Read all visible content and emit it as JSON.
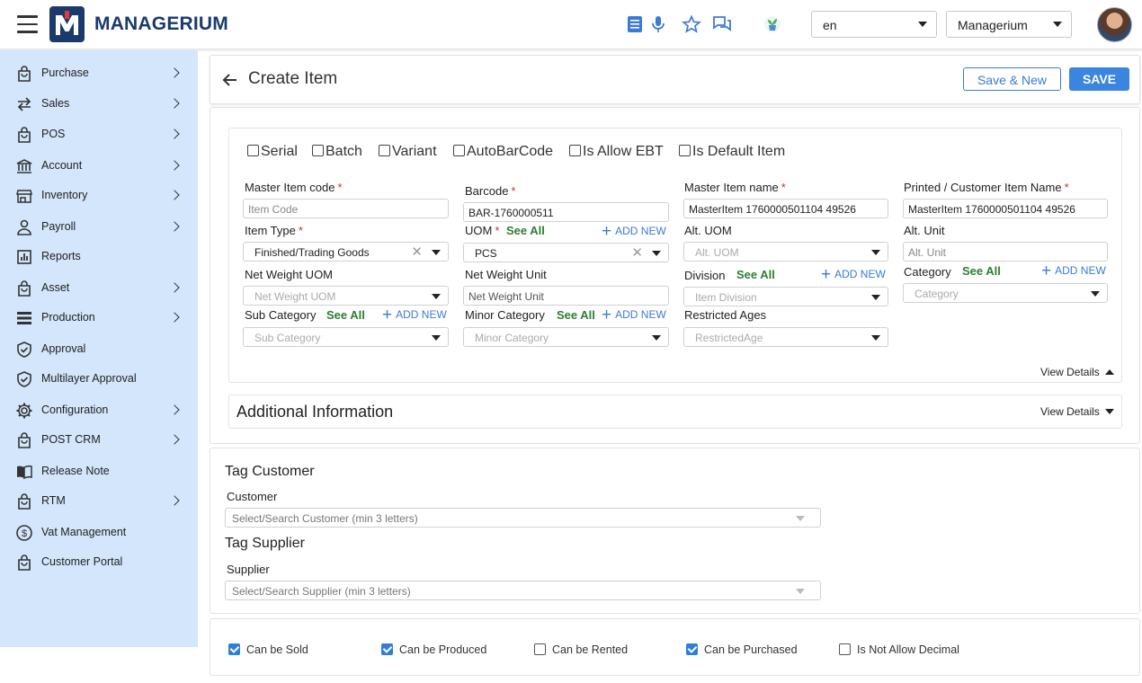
{
  "header": {
    "brand": "MANAGERIUM",
    "language": "en",
    "company": "Managerium"
  },
  "sidebar": {
    "items": [
      {
        "label": "Purchase",
        "icon": "shopping-bag-icon",
        "has_children": true
      },
      {
        "label": "Sales",
        "icon": "swap-arrows-icon",
        "has_children": true
      },
      {
        "label": "POS",
        "icon": "shopping-bag-icon",
        "has_children": true
      },
      {
        "label": "Account",
        "icon": "bank-icon",
        "has_children": true
      },
      {
        "label": "Inventory",
        "icon": "store-icon",
        "has_children": true
      },
      {
        "label": "Payroll",
        "icon": "person-icon",
        "has_children": true
      },
      {
        "label": "Reports",
        "icon": "bar-chart-icon",
        "has_children": false
      },
      {
        "label": "Asset",
        "icon": "shopping-bag-icon",
        "has_children": true
      },
      {
        "label": "Production",
        "icon": "stack-icon",
        "has_children": true
      },
      {
        "label": "Approval",
        "icon": "shield-check-icon",
        "has_children": false
      },
      {
        "label": "Multilayer Approval",
        "icon": "shield-check-icon",
        "has_children": false
      },
      {
        "label": "Configuration",
        "icon": "gear-icon",
        "has_children": true
      },
      {
        "label": "POST CRM",
        "icon": "shopping-bag-icon",
        "has_children": true
      },
      {
        "label": "Release Note",
        "icon": "book-icon",
        "has_children": false
      },
      {
        "label": "RTM",
        "icon": "shopping-bag-icon",
        "has_children": true
      },
      {
        "label": "Vat Management",
        "icon": "dollar-circle-icon",
        "has_children": false
      },
      {
        "label": "Customer Portal",
        "icon": "shopping-bag-icon",
        "has_children": false
      }
    ]
  },
  "page": {
    "title": "Create Item",
    "save_new_label": "Save & New",
    "save_label": "SAVE"
  },
  "options": {
    "serial": "Serial",
    "batch": "Batch",
    "variant": "Variant",
    "autobarcode": "AutoBarCode",
    "allow_ebt": "Is Allow EBT",
    "default_item": "Is Default Item"
  },
  "form": {
    "see_all": "See All",
    "add_new": "ADD NEW",
    "master_item_code": {
      "label": "Master Item code",
      "placeholder": "Item Code"
    },
    "barcode": {
      "label": "Barcode",
      "value": "BAR-1760000511"
    },
    "master_item_name": {
      "label": "Master Item name",
      "value": "MasterItem 1760000501104 49526"
    },
    "printed_name": {
      "label": "Printed / Customer Item Name",
      "value": "MasterItem 1760000501104 49526"
    },
    "item_type": {
      "label": "Item Type",
      "value": "Finished/Trading Goods"
    },
    "uom": {
      "label": "UOM",
      "value": "PCS"
    },
    "alt_uom": {
      "label": "Alt. UOM",
      "placeholder": "Alt. UOM"
    },
    "alt_unit": {
      "label": "Alt. Unit",
      "placeholder": "Alt. Unit"
    },
    "net_weight_uom": {
      "label": "Net Weight UOM",
      "placeholder": "Net Weight UOM"
    },
    "net_weight_unit": {
      "label": "Net Weight Unit",
      "placeholder": "Net Weight Unit"
    },
    "division": {
      "label": "Division",
      "placeholder": "Item Division"
    },
    "category": {
      "label": "Category",
      "placeholder": "Category"
    },
    "sub_category": {
      "label": "Sub Category",
      "placeholder": "Sub Category"
    },
    "minor_category": {
      "label": "Minor Category",
      "placeholder": "Minor Category"
    },
    "restricted_ages": {
      "label": "Restricted Ages",
      "placeholder": "RestrictedAge"
    },
    "view_details": "View Details"
  },
  "additional": {
    "title": "Additional Information",
    "view_details": "View Details"
  },
  "tags": {
    "customer_title": "Tag Customer",
    "customer_label": "Customer",
    "customer_placeholder": "Select/Search Customer (min 3 letters)",
    "supplier_title": "Tag Supplier",
    "supplier_label": "Supplier",
    "supplier_placeholder": "Select/Search Supplier (min 3 letters)"
  },
  "flags": {
    "can_be_sold": {
      "label": "Can be Sold",
      "checked": true
    },
    "can_be_produced": {
      "label": "Can be Produced",
      "checked": true
    },
    "can_be_rented": {
      "label": "Can be Rented",
      "checked": false
    },
    "can_be_purchased": {
      "label": "Can be Purchased",
      "checked": true
    },
    "not_allow_decimal": {
      "label": "Is Not Allow Decimal",
      "checked": false
    }
  },
  "colors": {
    "brand": "#1a3a6e",
    "sidebar_bg": "#d3e6fb",
    "primary": "#3a85e0",
    "see_all": "#2e7d32",
    "required": "#d32f2f"
  }
}
